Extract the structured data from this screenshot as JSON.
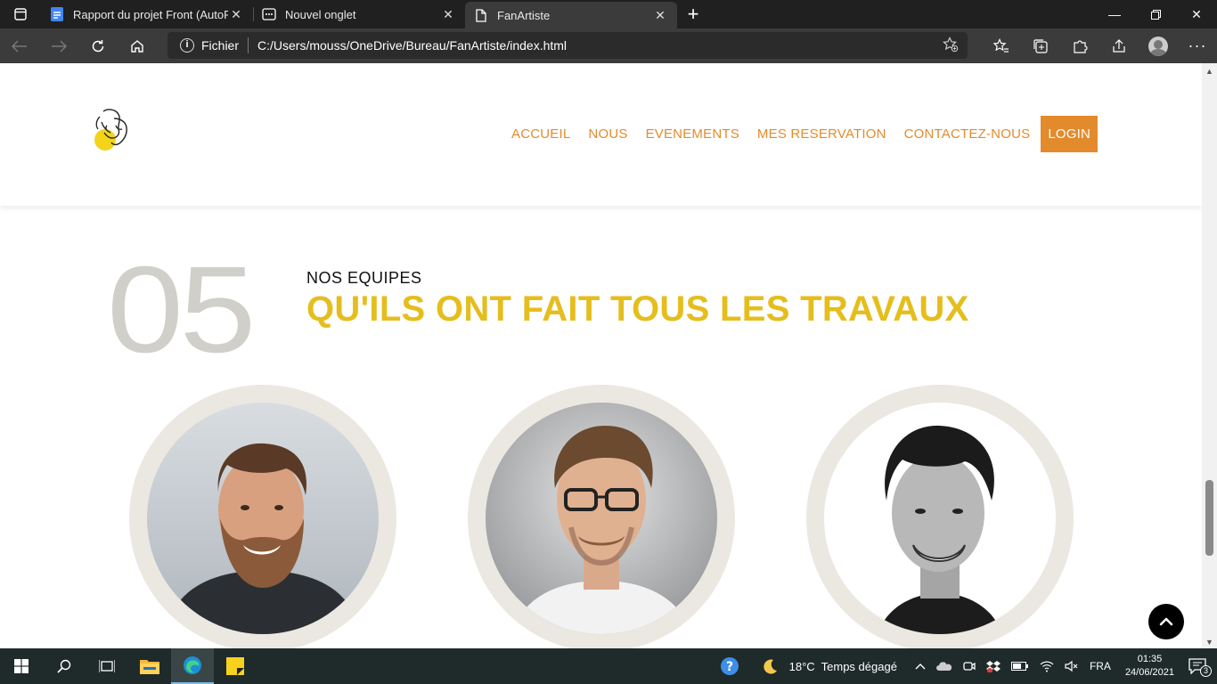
{
  "browser": {
    "tabs": [
      {
        "title": "Rapport du projet Front (AutoRe",
        "icon": "docs-icon",
        "active": false
      },
      {
        "title": "Nouvel onglet",
        "icon": "new-tab-page-icon",
        "active": false
      },
      {
        "title": "FanArtiste",
        "icon": "page-icon",
        "active": true
      }
    ],
    "address": {
      "scheme_label": "Fichier",
      "url": "C:/Users/mouss/OneDrive/Bureau/FanArtiste/index.html"
    }
  },
  "site": {
    "nav": {
      "items": [
        "ACCUEIL",
        "NOUS",
        "EVENEMENTS",
        "MES RESERVATION",
        "CONTACTEZ-NOUS"
      ],
      "login": "LOGIN"
    },
    "section": {
      "number": "05",
      "eyebrow": "NOS EQUIPES",
      "headline": "QU'ILS ONT FAIT TOUS LES TRAVAUX"
    },
    "colors": {
      "accent_orange": "#e38b2c",
      "accent_yellow": "#e5be1d",
      "number_gray": "#d0cfc9"
    }
  },
  "taskbar": {
    "weather": "18°C  Temps dégagé",
    "language": "FRA",
    "time": "01:35",
    "date": "24/06/2021",
    "notifications": "3"
  }
}
